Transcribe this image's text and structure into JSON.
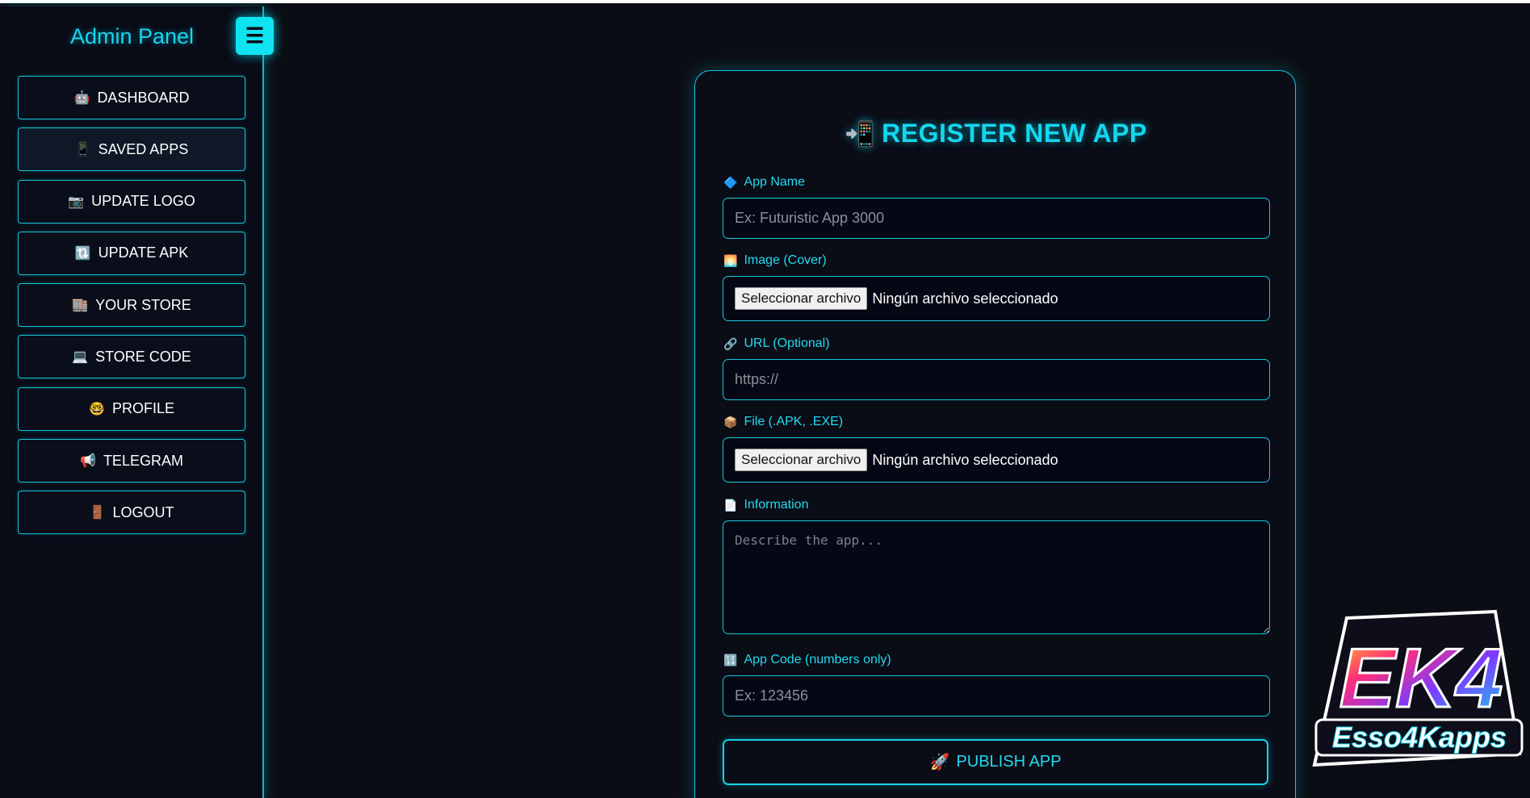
{
  "sidebar": {
    "title": "Admin Panel",
    "toggle_icon": "☰",
    "items": [
      {
        "icon": "🤖",
        "label": "DASHBOARD"
      },
      {
        "icon": "📱",
        "label": "SAVED APPS"
      },
      {
        "icon": "📷",
        "label": "UPDATE LOGO"
      },
      {
        "icon": "🔃",
        "label": "UPDATE APK"
      },
      {
        "icon": "🏬",
        "label": "YOUR STORE"
      },
      {
        "icon": "💻",
        "label": "STORE CODE"
      },
      {
        "icon": "🤓",
        "label": "PROFILE"
      },
      {
        "icon": "📢",
        "label": "TELEGRAM"
      },
      {
        "icon": "🚪",
        "label": "LOGOUT"
      }
    ]
  },
  "form": {
    "title_icon": "📲",
    "title": "REGISTER NEW APP",
    "app_name": {
      "icon": "🔷",
      "label": "App Name",
      "placeholder": "Ex: Futuristic App 3000"
    },
    "image": {
      "icon": "🌅",
      "label": "Image (Cover)",
      "button": "Seleccionar archivo",
      "status": "Ningún archivo seleccionado"
    },
    "url": {
      "icon": "🔗",
      "label": "URL (Optional)",
      "placeholder": "https://"
    },
    "file": {
      "icon": "📦",
      "label": "File (.APK, .EXE)",
      "button": "Seleccionar archivo",
      "status": "Ningún archivo seleccionado"
    },
    "information": {
      "icon": "📄",
      "label": "Information",
      "placeholder": "Describe the app..."
    },
    "app_code": {
      "icon": "🔢",
      "label": "App Code (numbers only)",
      "placeholder": "Ex: 123456"
    },
    "publish": {
      "icon": "🚀",
      "label": "PUBLISH APP"
    }
  },
  "logo": {
    "text_main": "EK4",
    "text_sub": "Esso4Kapps"
  },
  "colors": {
    "accent": "#14c9dd",
    "background": "#0b0d14",
    "sidebar_bg": "#090b16"
  }
}
